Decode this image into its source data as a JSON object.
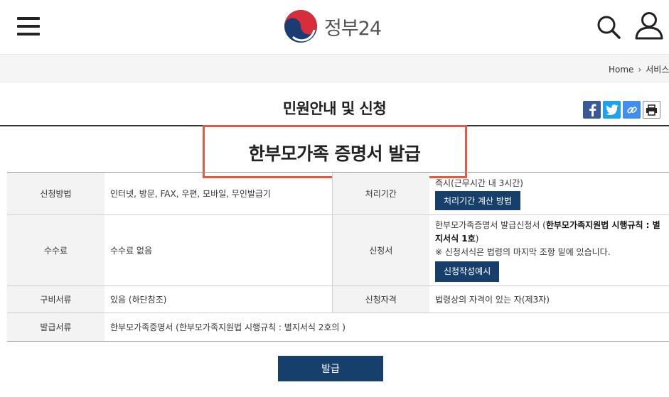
{
  "header": {
    "logo_text": "정부24",
    "menu_icon": "hamburger-menu-icon",
    "search_icon": "search-icon",
    "user_icon": "user-icon"
  },
  "breadcrumb": {
    "home": "Home",
    "current": "서비스"
  },
  "page_title": "민원안내 및 신청",
  "share": {
    "facebook": "facebook-icon",
    "twitter": "twitter-icon",
    "link": "link-icon",
    "print": "print-icon"
  },
  "service_title": "한부모가족 증명서 발급",
  "table": {
    "method_label": "신청방법",
    "method_value": "인터넷, 방문, FAX, 우편, 모바일, 무인발급기",
    "period_label": "처리기간",
    "period_value": "즉시(근무시간 내 3시간)",
    "period_button": "처리기간 계산 방법",
    "fee_label": "수수료",
    "fee_value": "수수료 없음",
    "form_label": "신청서",
    "form_value_plain": "한부모가족증명서 발급신청서 (",
    "form_value_bold": "한부모가족지원법 시행규칙 : 별지서식 1호",
    "form_value_end": ")",
    "form_note": "※ 신청서식은 법령의 마지막 조항 밑에 있습니다.",
    "form_button": "신청작성예시",
    "docs_label": "구비서류",
    "docs_value": "있음 (하단참조)",
    "eligibility_label": "신청자격",
    "eligibility_value": "법령상의 자격이 있는 자(제3자)",
    "issued_label": "발급서류",
    "issued_value": "한부모가족증명서 (한부모가족지원법 시행규칙 : 별지서식 2호의 )"
  },
  "issue_button": "발급",
  "colors": {
    "navy": "#173f6b",
    "highlight": "#e05a47"
  }
}
